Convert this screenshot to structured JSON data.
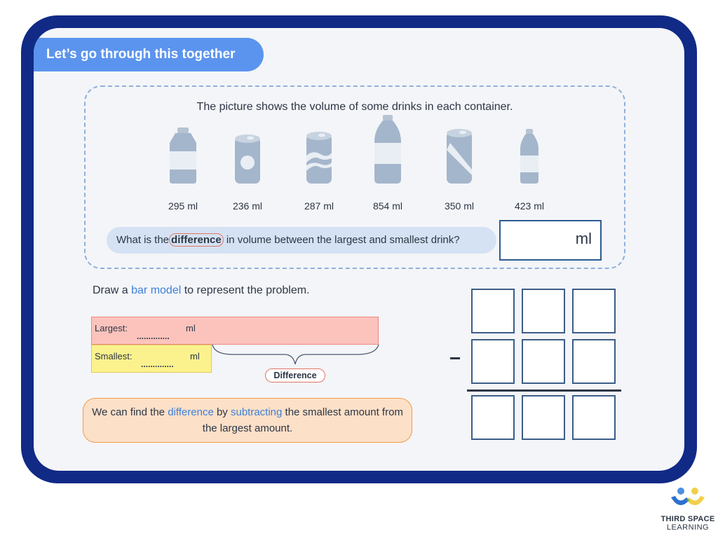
{
  "banner": {
    "title": "Let’s go through this together"
  },
  "question": {
    "intro": "The picture shows the volume of some drinks in each container.",
    "drinks": [
      {
        "type": "jar-bottle",
        "icon": "bottle-icon",
        "label": "295 ml"
      },
      {
        "type": "can-circle",
        "icon": "can-icon",
        "label": "236 ml"
      },
      {
        "type": "can-wave",
        "icon": "can-icon",
        "label": "287 ml"
      },
      {
        "type": "tall-bottle",
        "icon": "bottle-icon",
        "label": "854 ml"
      },
      {
        "type": "can-stripe",
        "icon": "can-icon",
        "label": "350 ml"
      },
      {
        "type": "slim-bottle",
        "icon": "bottle-icon",
        "label": "423 ml"
      }
    ],
    "prompt_before": "What is the",
    "prompt_keyword": "difference",
    "prompt_after": "in volume between the largest and smallest drink?",
    "answer_unit": "ml",
    "answer_value": ""
  },
  "bar_model": {
    "title_before": "Draw a ",
    "title_keyword": "bar model",
    "title_after": " to represent the problem.",
    "largest_label": "Largest:",
    "largest_unit": "ml",
    "smallest_label": "Smallest:",
    "smallest_unit": "ml",
    "blank_dots": "..............",
    "difference_label": "Difference"
  },
  "hint": {
    "part1": "We can find the ",
    "keyword1": "difference",
    "part2": " by ",
    "keyword2": "subtracting",
    "part3": " the smallest amount from the largest amount."
  },
  "subtraction_grid": {
    "rows": 3,
    "cols": 3,
    "operator": "−"
  },
  "logo": {
    "line1": "THIRD SPACE",
    "line2": "LEARNING"
  },
  "colors": {
    "frame": "#112a86",
    "banner": "#5b94ee",
    "accent_blue": "#3e7fd9",
    "largest_bar": "#fcc3bd",
    "smallest_bar": "#fbf28e",
    "hint_bg": "#fde0c8"
  }
}
